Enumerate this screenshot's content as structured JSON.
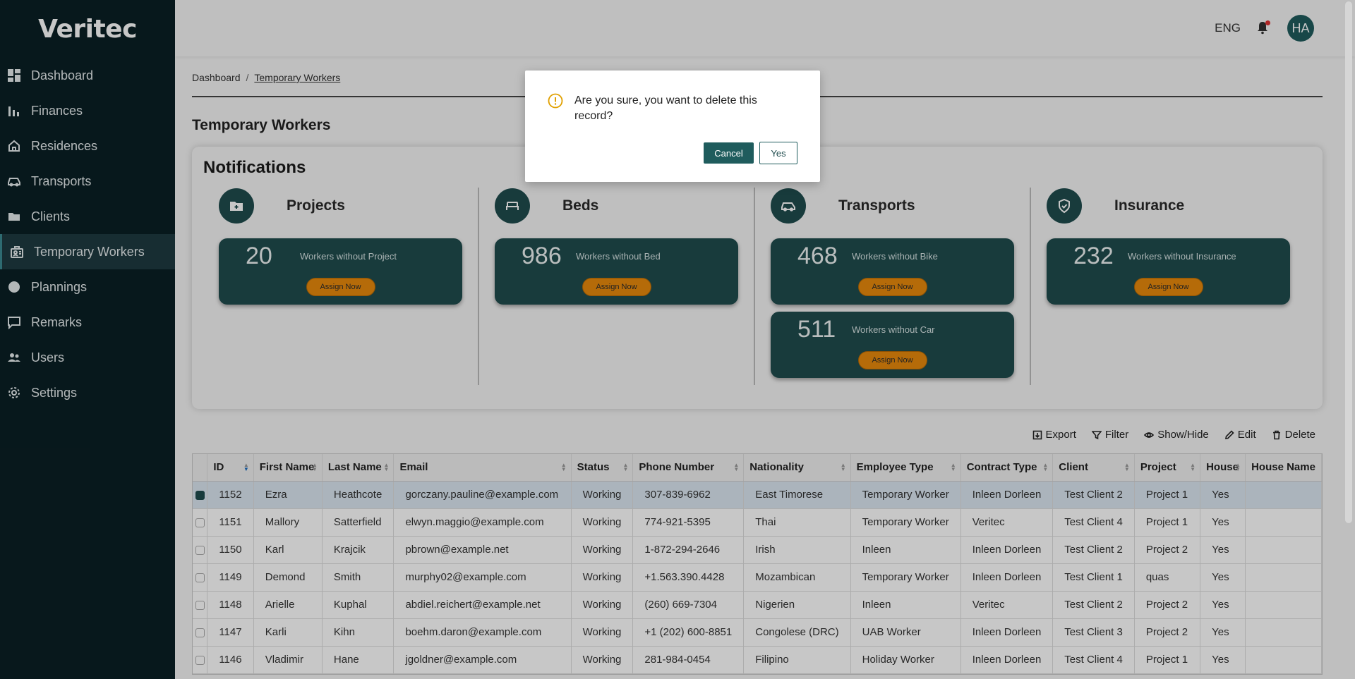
{
  "app": {
    "logo": "Veritec"
  },
  "sidebar": {
    "items": [
      {
        "label": "Dashboard",
        "icon": "dashboard-icon",
        "active": false
      },
      {
        "label": "Finances",
        "icon": "bar-chart-icon",
        "active": false
      },
      {
        "label": "Residences",
        "icon": "home-icon",
        "active": false
      },
      {
        "label": "Transports",
        "icon": "car-icon",
        "active": false
      },
      {
        "label": "Clients",
        "icon": "folder-icon",
        "active": false
      },
      {
        "label": "Temporary Workers",
        "icon": "worker-badge-icon",
        "active": true
      },
      {
        "label": "Plannings",
        "icon": "globe-icon",
        "active": false
      },
      {
        "label": "Remarks",
        "icon": "comment-icon",
        "active": false
      },
      {
        "label": "Users",
        "icon": "users-icon",
        "active": false
      },
      {
        "label": "Settings",
        "icon": "gear-icon",
        "active": false
      }
    ]
  },
  "header": {
    "language": "ENG",
    "avatar_initials": "HA",
    "notification_dot_color": "#e03131"
  },
  "breadcrumb": {
    "root": "Dashboard",
    "separator": "/",
    "current": "Temporary Workers"
  },
  "page": {
    "title": "Temporary Workers"
  },
  "notifications": {
    "title": "Notifications",
    "columns": [
      {
        "name": "Projects",
        "icon": "folder-plus-icon",
        "stats": [
          {
            "value": "20",
            "label": "Workers without Project",
            "button": "Assign Now"
          }
        ]
      },
      {
        "name": "Beds",
        "icon": "bed-icon",
        "stats": [
          {
            "value": "986",
            "label": "Workers without Bed",
            "button": "Assign Now"
          }
        ]
      },
      {
        "name": "Transports",
        "icon": "car-icon",
        "stats": [
          {
            "value": "468",
            "label": "Workers without Bike",
            "button": "Assign Now"
          },
          {
            "value": "511",
            "label": "Workers without Car",
            "button": "Assign Now"
          }
        ]
      },
      {
        "name": "Insurance",
        "icon": "shield-check-icon",
        "stats": [
          {
            "value": "232",
            "label": "Workers without Insurance",
            "button": "Assign Now"
          }
        ]
      }
    ]
  },
  "toolbar": {
    "export": "Export",
    "filter": "Filter",
    "show_hide": "Show/Hide",
    "edit": "Edit",
    "delete": "Delete"
  },
  "table": {
    "columns": [
      "ID",
      "First Name",
      "Last Name",
      "Email",
      "Status",
      "Phone Number",
      "Nationality",
      "Employee Type",
      "Contract Type",
      "Client",
      "Project",
      "House",
      "House Name"
    ],
    "rows": [
      {
        "selected": true,
        "cells": [
          "1152",
          "Ezra",
          "Heathcote",
          "gorczany.pauline@example.com",
          "Working",
          "307-839-6962",
          "East Timorese",
          "Temporary Worker",
          "Inleen Dorleen",
          "Test Client 2",
          "Project 1",
          "Yes",
          ""
        ]
      },
      {
        "selected": false,
        "cells": [
          "1151",
          "Mallory",
          "Satterfield",
          "elwyn.maggio@example.com",
          "Working",
          "774-921-5395",
          "Thai",
          "Temporary Worker",
          "Veritec",
          "Test Client 4",
          "Project 1",
          "Yes",
          ""
        ]
      },
      {
        "selected": false,
        "cells": [
          "1150",
          "Karl",
          "Krajcik",
          "pbrown@example.net",
          "Working",
          "1-872-294-2646",
          "Irish",
          "Inleen",
          "Inleen Dorleen",
          "Test Client 2",
          "Project 2",
          "Yes",
          ""
        ]
      },
      {
        "selected": false,
        "cells": [
          "1149",
          "Demond",
          "Smith",
          "murphy02@example.com",
          "Working",
          "+1.563.390.4428",
          "Mozambican",
          "Temporary Worker",
          "Inleen Dorleen",
          "Test Client 1",
          "quas",
          "Yes",
          ""
        ]
      },
      {
        "selected": false,
        "cells": [
          "1148",
          "Arielle",
          "Kuphal",
          "abdiel.reichert@example.net",
          "Working",
          "(260) 669-7304",
          "Nigerien",
          "Inleen",
          "Veritec",
          "Test Client 2",
          "Project 2",
          "Yes",
          ""
        ]
      },
      {
        "selected": false,
        "cells": [
          "1147",
          "Karli",
          "Kihn",
          "boehm.daron@example.com",
          "Working",
          "+1 (202) 600-8851",
          "Congolese (DRC)",
          "UAB Worker",
          "Inleen Dorleen",
          "Test Client 3",
          "Project 2",
          "Yes",
          ""
        ]
      },
      {
        "selected": false,
        "cells": [
          "1146",
          "Vladimir",
          "Hane",
          "jgoldner@example.com",
          "Working",
          "281-984-0454",
          "Filipino",
          "Holiday Worker",
          "Inleen Dorleen",
          "Test Client 4",
          "Project 1",
          "Yes",
          ""
        ]
      }
    ]
  },
  "dialog": {
    "message": "Are you sure, you want to delete this record?",
    "icon": "warning-circle-icon",
    "cancel_label": "Cancel",
    "confirm_label": "Yes"
  }
}
